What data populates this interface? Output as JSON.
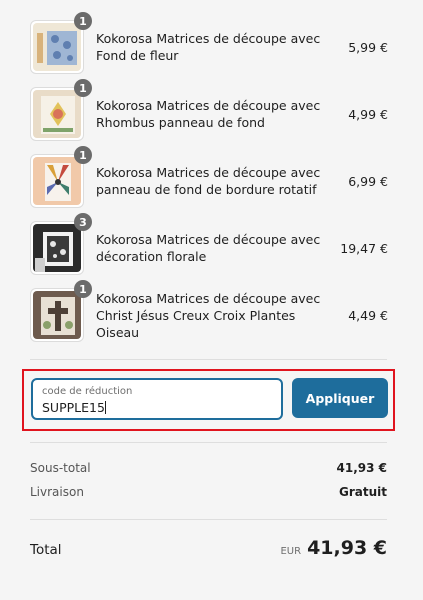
{
  "cart": {
    "items": [
      {
        "qty": "1",
        "name": "Kokorosa Matrices de découpe avec Fond de fleur",
        "price": "5,99 €",
        "thumb_icon": "flower-background-die-icon"
      },
      {
        "qty": "1",
        "name": "Kokorosa Matrices de découpe avec Rhombus panneau de fond",
        "price": "4,99 €",
        "thumb_icon": "rhombus-panel-die-icon"
      },
      {
        "qty": "1",
        "name": "Kokorosa Matrices de découpe avec panneau de fond de bordure rotatif",
        "price": "6,99 €",
        "thumb_icon": "rotating-border-panel-die-icon"
      },
      {
        "qty": "3",
        "name": "Kokorosa Matrices de découpe avec décoration florale",
        "price": "19,47 €",
        "thumb_icon": "floral-decoration-die-icon"
      },
      {
        "qty": "1",
        "name": "Kokorosa Matrices de découpe avec Christ Jésus Creux Croix Plantes Oiseau",
        "price": "4,49 €",
        "thumb_icon": "cross-plants-bird-die-icon"
      }
    ]
  },
  "discount": {
    "label": "code de réduction",
    "value": "SUPPLE15",
    "apply_label": "Appliquer"
  },
  "summary": {
    "subtotal_label": "Sous-total",
    "subtotal_value": "41,93 €",
    "shipping_label": "Livraison",
    "shipping_value": "Gratuit",
    "total_label": "Total",
    "currency": "EUR",
    "total_value": "41,93 €"
  },
  "colors": {
    "accent": "#1e6d9c",
    "highlight_border": "#e0141e",
    "background": "#f5f5f5"
  }
}
